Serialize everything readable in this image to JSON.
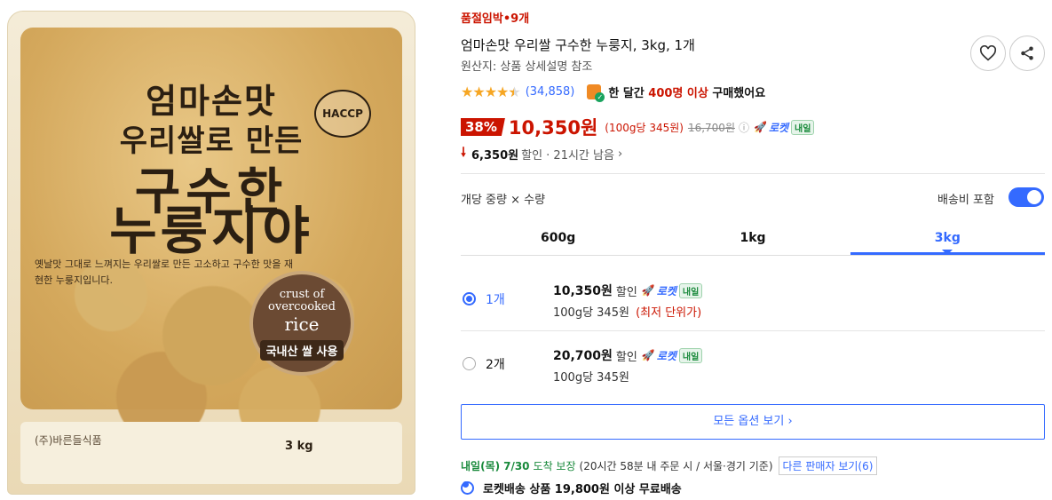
{
  "image": {
    "bag_line1": "엄마손맛",
    "bag_line2": "우리쌀로 만든",
    "bag_line3": "구수한",
    "bag_line4": "누룽지야",
    "bag_desc": "옛날맛 그대로 느껴지는 우리쌀로 만든 고소하고 구수한 맛을 재현한 누룽지입니다.",
    "haccp": "HACCP",
    "seal_line1": "crust of overcooked",
    "seal_line2": "rice",
    "seal_line3": "국내산 쌀 사용",
    "brand": "(주)바른들식품",
    "weight": "3 kg"
  },
  "product": {
    "stock_warning": "품절임박•9개",
    "title": "엄마손맛 우리쌀 구수한 누룽지, 3kg, 1개",
    "origin": "원산지: 상품 상세설명 참조",
    "rating": 4.5,
    "review_count": "(34,858)",
    "purchase_text_prefix": "한 달간 ",
    "purchase_highlight": "400명 이상",
    "purchase_text_suffix": " 구매했어요"
  },
  "price": {
    "discount": "38%",
    "sale": "10,350원",
    "unit": "(100g당 345원)",
    "original": "16,700원",
    "info_icon": "ⓘ",
    "rocket_label": "로켓",
    "tomorrow_badge": "내일",
    "saving_amount": "6,350원",
    "saving_rest": "할인 · 21시간 남음"
  },
  "options": {
    "heading": "개당 중량 × 수량",
    "shipping_toggle_label": "배송비 포함",
    "shipping_toggle_on": true,
    "tabs": [
      "600g",
      "1kg",
      "3kg"
    ],
    "active_tab": "3kg",
    "rows": [
      {
        "qty": "1개",
        "price": "10,350원",
        "disc": "할인",
        "unit": "100g당 345원",
        "lowest": "(최저 단위가)",
        "selected": true
      },
      {
        "qty": "2개",
        "price": "20,700원",
        "disc": "할인",
        "unit": "100g당 345원",
        "lowest": "",
        "selected": false
      }
    ],
    "all_options_button": "모든 옵션 보기 ›"
  },
  "delivery": {
    "date": "내일(목)",
    "date_num": "7/30",
    "guarantee": "도착 보장",
    "detail": "(20시간 58분 내 주문 시 / 서울·경기 기준)",
    "other_sellers": "다른 판매자 보기(6)",
    "free_shipping": "로켓배송 상품 19,800원 이상 무료배송"
  },
  "colors": {
    "accent_blue": "#346aff",
    "sale_red": "#cb1400",
    "rocket_green": "#1a8a3c",
    "star_gold": "#f6a623"
  }
}
